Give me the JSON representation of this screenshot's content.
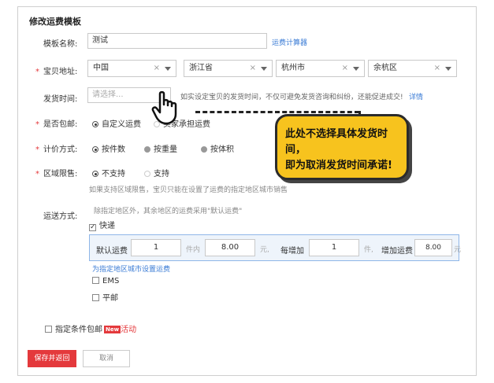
{
  "page": {
    "title": "修改运费模板"
  },
  "template_name": {
    "label": "模板名称:",
    "value": "测试",
    "calc_link": "运费计算器"
  },
  "address": {
    "label": "宝贝地址:",
    "country": "中国",
    "province": "浙江省",
    "city": "杭州市",
    "district": "余杭区",
    "clear_glyph": "×"
  },
  "ship_time": {
    "label": "发货时间:",
    "placeholder": "请选择...",
    "notice": "如实设定宝贝的发货时间，不仅可避免发货咨询和纠纷，还能促进成交!",
    "detail_link": "详情"
  },
  "free_shipping": {
    "label": "是否包邮:",
    "options": [
      "自定义运费",
      "卖家承担运费"
    ],
    "selected": 0
  },
  "pricing": {
    "label": "计价方式:",
    "options": [
      "按件数",
      "按重量",
      "按体积"
    ],
    "selected": 0
  },
  "region_limit": {
    "label": "区域限售:",
    "options": [
      "不支持",
      "支持"
    ],
    "selected": 0,
    "hint": "如果支持区域限售，宝贝只能在设置了运费的指定地区城市销售"
  },
  "delivery": {
    "label": "运送方式:",
    "hint": "除指定地区外，其余地区的运费采用\"默认运费\"",
    "express_label": "快递",
    "express_checked": true,
    "fee": {
      "default_label": "默认运费",
      "default_qty": "1",
      "unit_within": "件内",
      "default_price": "8.00",
      "yuan1": "元,",
      "each_add_label": "每增加",
      "add_qty": "1",
      "unit_item": "件,",
      "add_fee_label": "增加运费",
      "add_price": "8.00",
      "yuan2": "元"
    },
    "region_link": "为指定地区城市设置运费",
    "ems_label": "EMS",
    "post_label": "平邮"
  },
  "conditional_free": {
    "label": "指定条件包邮",
    "badge": "New",
    "activity": "活动"
  },
  "actions": {
    "save_label": "保存并返回",
    "cancel_label": "取消"
  },
  "callout": {
    "line1": "此处不选择具体发货时间，",
    "line2": "即为取消发货时间承诺!"
  },
  "colors": {
    "primary_red": "#e4393c",
    "link_blue": "#3a7bd5",
    "callout_yellow": "#f7c31e",
    "fee_box_bg": "#eef4fb"
  }
}
